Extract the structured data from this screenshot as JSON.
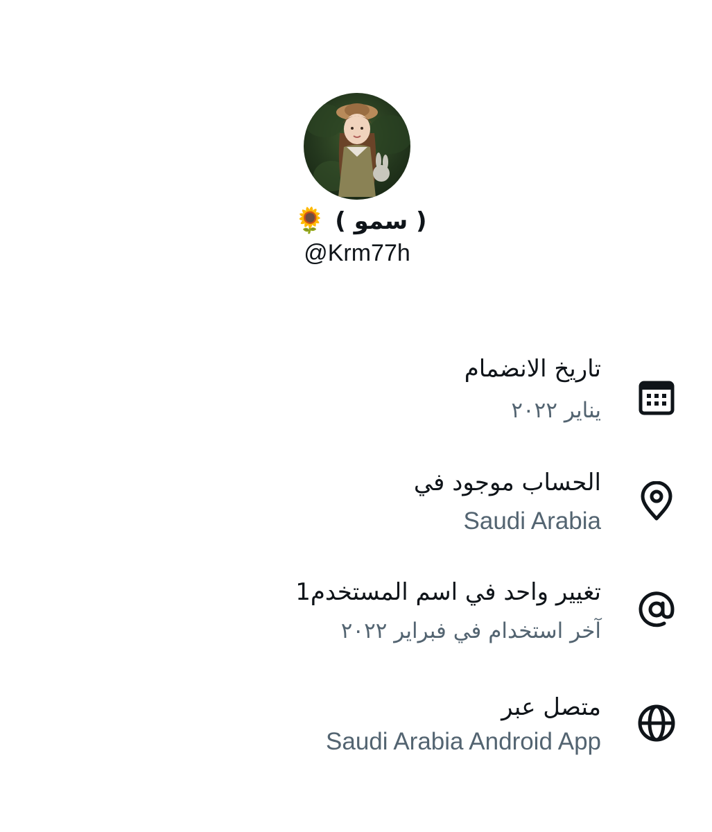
{
  "profile": {
    "display_name": "( سمو )",
    "display_emoji": "🌻",
    "handle": "@Krm77h"
  },
  "info": [
    {
      "icon": "calendar-icon",
      "title": "تاريخ الانضمام",
      "value": "يناير ٢٠٢٢"
    },
    {
      "icon": "location-pin-icon",
      "title": "الحساب موجود في",
      "value": "Saudi Arabia"
    },
    {
      "icon": "at-sign-icon",
      "title": "تغيير واحد في اسم المستخدم1",
      "value": "آخر استخدام في فبراير ٢٠٢٢"
    },
    {
      "icon": "globe-icon",
      "title": "متصل عبر",
      "value": "Saudi Arabia Android App"
    }
  ],
  "colors": {
    "primary_text": "#0f1419",
    "secondary_text": "#536471",
    "icon": "#0f1419",
    "background": "#ffffff"
  }
}
